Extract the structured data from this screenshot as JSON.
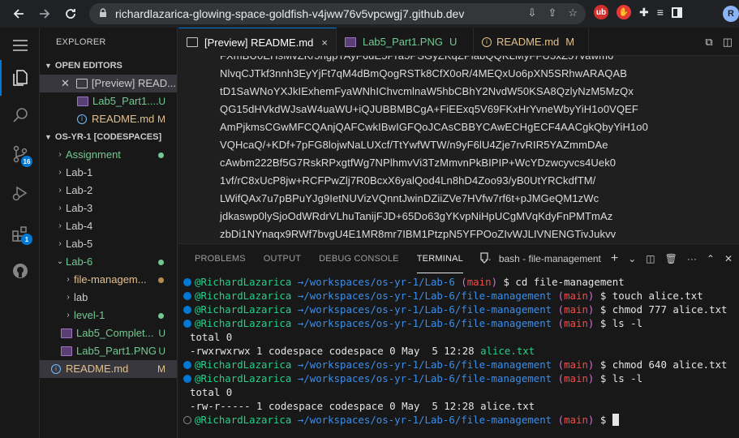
{
  "browser": {
    "url": "richardlazarica-glowing-space-goldfish-v4jww76v5vpcwgj7.github.dev",
    "profile_initial": "R"
  },
  "sidebar": {
    "title": "EXPLORER",
    "open_editors_header": "OPEN EDITORS",
    "open_editors": [
      {
        "label": "[Preview] READ...",
        "status": ""
      },
      {
        "label": "Lab5_Part1....",
        "status": "U"
      },
      {
        "label": "README.md",
        "status": "M"
      }
    ],
    "workspace_header": "OS-YR-1 [CODESPACES]",
    "tree": [
      {
        "label": "Assignment",
        "status": "dot-green"
      },
      {
        "label": "Lab-1"
      },
      {
        "label": "Lab-2"
      },
      {
        "label": "Lab-3"
      },
      {
        "label": "Lab-4"
      },
      {
        "label": "Lab-5"
      },
      {
        "label": "Lab-6",
        "status": "dot-green"
      },
      {
        "label": "file-managem...",
        "status": "dot-orange"
      },
      {
        "label": "lab"
      },
      {
        "label": "level-1",
        "status": "dot-green"
      },
      {
        "label": "Lab5_Complet...",
        "status": "U"
      },
      {
        "label": "Lab5_Part1.PNG",
        "status": "U"
      },
      {
        "label": "README.md",
        "status": "M"
      }
    ]
  },
  "tabs": [
    {
      "label": "[Preview] README.md",
      "close": "×"
    },
    {
      "label": "Lab5_Part1.PNG",
      "mod": "U"
    },
    {
      "label": "README.md",
      "mod": "M"
    }
  ],
  "editor_lines": [
    "FXmBU0EHsMvZK/5ngpTAyF6uE5Pra5PSGyZKqZPlabQQKLMyFFU5xZ57vawm6",
    "NlvqCJTkf3nnh3EyYjFt7qM4dBmQogRSTk8CfX0oR/4MEQxUo6pXN5SRhwARAQAB",
    "tD1SaWNoYXJkIExhemFyaWNhIChvcmlnaW5hbCBhY2NvdW50KSA8QzlyNzM5MzQx",
    "QG15dHVkdWJsaW4uaWU+iQJUBBMBCgA+FiEExq5V69FKxHrYvneWbyYiH1o0VQEF",
    "AmPjkmsCGwMFCQAnjQAFCwkIBwIGFQoJCAsCBBYCAwECHgECF4AACgkQbyYiH1o0",
    "VQHcaQ/+KDf+7pFG8lojwNaLUXcf/TtYwfWTW/n9yF6lU4Zje7rvRIR5YAZmmDAe",
    "cAwbm222Bf5G7RskRPxgtfWg7NPlhmvVi3TzMmvnPkBIPIP+WcYDzwcyvcs4Uek0",
    "1vf/rC8xUcP8jw+RCFPwZlj7R0BcxX6yalQod4Ln8hD4Zoo93/yB0UtYRCkdfTM/",
    "LWifQAx7u7pBPuYJg9IetNUVizVQnntJwinDZiiZVe7HVfw7rf6t+pJMGeQM1zWc",
    "jdkaswp0lySjoOdWRdrVLhuTanijFJD+65Do63gYKvpNiHpUCgMVqKdyFnPMTmAz",
    "zbDi1NYnaqx9RWf7bvgU4E1MR8mr7IBM1PtzpN5YFPOoZIvWJLIVNENGTivJukvv"
  ],
  "panel": {
    "tabs": [
      "PROBLEMS",
      "OUTPUT",
      "DEBUG CONSOLE",
      "TERMINAL"
    ],
    "more": "···",
    "terminal_name": "bash - file-management"
  },
  "terminal": [
    {
      "dot": "blue",
      "user": "@RichardLazarica",
      "path": "/workspaces/os-yr-1/Lab-6",
      "branch": "main",
      "cmd": "cd file-management"
    },
    {
      "dot": "blue",
      "user": "@RichardLazarica",
      "path": "/workspaces/os-yr-1/Lab-6/file-management",
      "branch": "main",
      "cmd": "touch alice.txt"
    },
    {
      "dot": "blue",
      "user": "@RichardLazarica",
      "path": "/workspaces/os-yr-1/Lab-6/file-management",
      "branch": "main",
      "cmd": "chmod 777 alice.txt"
    },
    {
      "dot": "blue",
      "user": "@RichardLazarica",
      "path": "/workspaces/os-yr-1/Lab-6/file-management",
      "branch": "main",
      "cmd": "ls -l"
    },
    {
      "plain": "total 0"
    },
    {
      "plain": "-rwxrwxrwx 1 codespace codespace 0 May  5 12:28 ",
      "file": "alice.txt"
    },
    {
      "dot": "blue",
      "user": "@RichardLazarica",
      "path": "/workspaces/os-yr-1/Lab-6/file-management",
      "branch": "main",
      "cmd": "chmod 640 alice.txt"
    },
    {
      "dot": "blue",
      "user": "@RichardLazarica",
      "path": "/workspaces/os-yr-1/Lab-6/file-management",
      "branch": "main",
      "cmd": "ls -l"
    },
    {
      "plain": "total 0"
    },
    {
      "plain": "-rw-r----- 1 codespace codespace 0 May  5 12:28 alice.txt"
    },
    {
      "dot": "grey",
      "user": "@RichardLazarica",
      "path": "/workspaces/os-yr-1/Lab-6/file-management",
      "branch": "main",
      "cmd": "",
      "cursor": true
    }
  ],
  "colors": {
    "accent": "#0078d4",
    "git_added": "#73c991",
    "git_modified": "#e2c08d",
    "terminal_user": "#23d18b",
    "terminal_path": "#3b8eea"
  }
}
